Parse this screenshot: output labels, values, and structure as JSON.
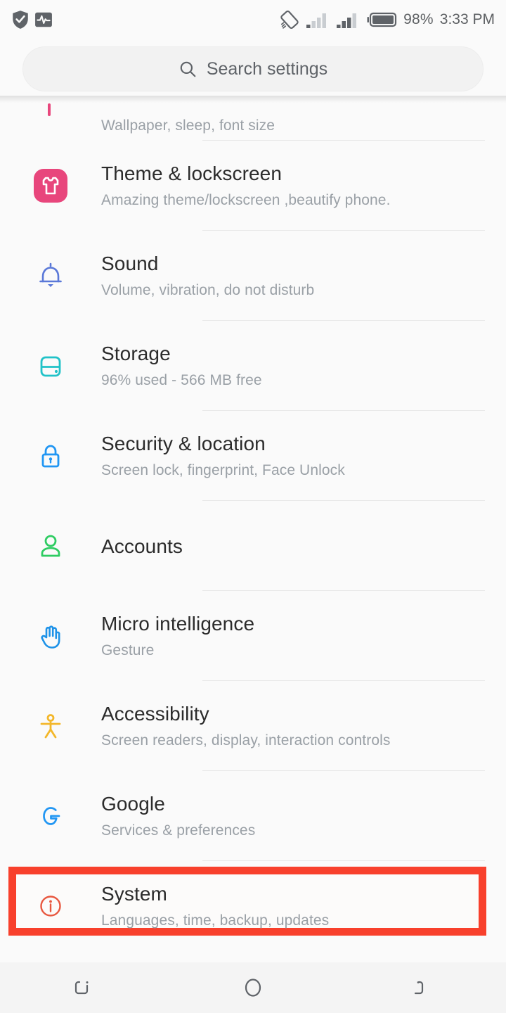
{
  "status_bar": {
    "left_icons": [
      "shield-check-icon",
      "activity-monitor-icon"
    ],
    "rotation_icon": "rotation-lock-icon",
    "signal_icons": [
      "signal-bars-sim1-icon",
      "signal-bars-sim2-icon"
    ],
    "battery_icon": "battery-icon",
    "battery_percent": "98%",
    "time": "3:33 PM"
  },
  "search": {
    "icon": "search-icon",
    "placeholder": "Search settings"
  },
  "settings": {
    "rows": [
      {
        "title": "",
        "subtitle": "Wallpaper, sleep, font size",
        "icon": "display-icon",
        "clipped": true
      },
      {
        "title": "Theme & lockscreen",
        "subtitle": "Amazing theme/lockscreen ,beautify phone.",
        "icon": "tshirt-theme-icon",
        "color": "#e8467c"
      },
      {
        "title": "Sound",
        "subtitle": "Volume, vibration, do not disturb",
        "icon": "bell-icon",
        "color": "#5a78d8"
      },
      {
        "title": "Storage",
        "subtitle": "96% used - 566 MB free",
        "icon": "storage-disk-icon",
        "color": "#21c2c8"
      },
      {
        "title": "Security & location",
        "subtitle": "Screen lock, fingerprint, Face Unlock",
        "icon": "lock-icon",
        "color": "#2196f3"
      },
      {
        "title": "Accounts",
        "subtitle": "",
        "icon": "person-icon",
        "color": "#2ecc62"
      },
      {
        "title": "Micro intelligence",
        "subtitle": "Gesture",
        "icon": "hand-gesture-icon",
        "color": "#1d92e8"
      },
      {
        "title": "Accessibility",
        "subtitle": "Screen readers, display, interaction controls",
        "icon": "accessibility-icon",
        "color": "#f3b72a"
      },
      {
        "title": "Google",
        "subtitle": "Services & preferences",
        "icon": "google-g-icon",
        "color": "#2196f3"
      },
      {
        "title": "System",
        "subtitle": "Languages, time, backup, updates",
        "icon": "info-circle-icon",
        "color": "#e8573f",
        "highlighted": true
      }
    ]
  },
  "highlight": {
    "target": "System",
    "color": "#f8402c"
  },
  "nav_bar": {
    "recents_icon": "recents-icon",
    "home_icon": "home-circle-icon",
    "back_icon": "back-icon"
  }
}
